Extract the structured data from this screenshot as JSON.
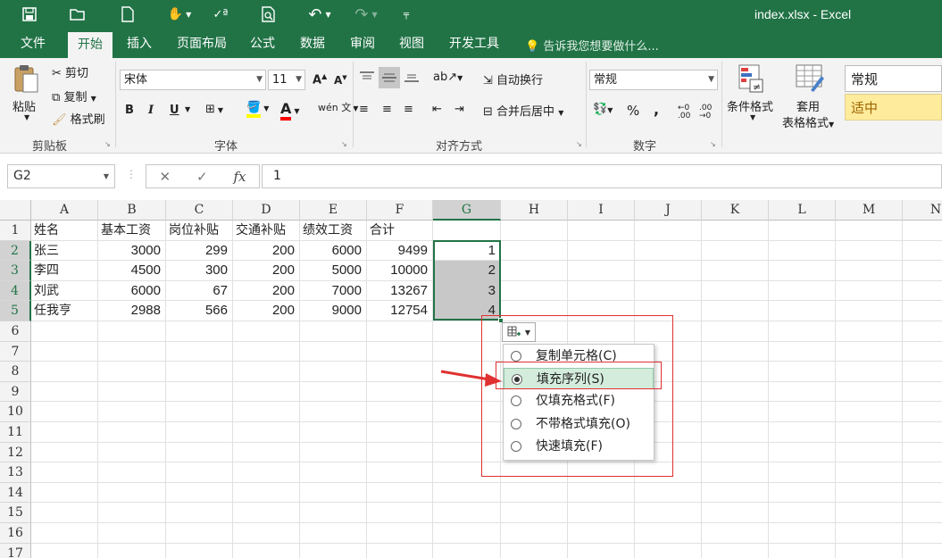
{
  "window": {
    "title": "index.xlsx - Excel"
  },
  "qat": {
    "undo_icon": "undo-icon",
    "redo_icon": "redo-icon"
  },
  "tabs": [
    "文件",
    "开始",
    "插入",
    "页面布局",
    "公式",
    "数据",
    "审阅",
    "视图",
    "开发工具"
  ],
  "tellme": "告诉我您想要做什么...",
  "clipboard": {
    "cut": "剪切",
    "copy": "复制",
    "paste": "粘贴",
    "format_painter": "格式刷",
    "label": "剪贴板"
  },
  "font": {
    "name": "宋体",
    "size": "11",
    "label": "字体",
    "grow": "A",
    "shrink": "A",
    "bold": "B",
    "italic": "I",
    "underline": "U",
    "wen": "wén 文"
  },
  "alignment": {
    "wrap": "自动换行",
    "merge": "合并后居中",
    "label": "对齐方式"
  },
  "number": {
    "format": "常规",
    "percent": "%",
    "comma": ",",
    "label": "数字",
    "inc_decimal": "←0 .00",
    "dec_decimal": ".00 →0"
  },
  "styles": {
    "conditional": "条件格式",
    "table_line1": "套用",
    "table_line2": "表格格式",
    "normal": "常规",
    "neutral": "适中"
  },
  "formula_bar": {
    "name_box": "G2",
    "formula": "1",
    "fx": "fx"
  },
  "columns": [
    "A",
    "B",
    "C",
    "D",
    "E",
    "F",
    "G",
    "H",
    "I",
    "J",
    "K",
    "L",
    "M",
    "N"
  ],
  "rows": [
    "1",
    "2",
    "3",
    "4",
    "5",
    "6",
    "7",
    "8",
    "9",
    "10",
    "11",
    "12",
    "13",
    "14",
    "15",
    "16",
    "17"
  ],
  "headers": [
    "姓名",
    "基本工资",
    "岗位补贴",
    "交通补贴",
    "绩效工资",
    "合计"
  ],
  "table": [
    {
      "name": "张三",
      "values": [
        "3000",
        "299",
        "200",
        "6000",
        "9499",
        "1"
      ]
    },
    {
      "name": "李四",
      "values": [
        "4500",
        "300",
        "200",
        "5000",
        "10000",
        "2"
      ]
    },
    {
      "name": "刘武",
      "values": [
        "6000",
        "67",
        "200",
        "7000",
        "13267",
        "3"
      ]
    },
    {
      "name": "任我亨",
      "values": [
        "2988",
        "566",
        "200",
        "9000",
        "12754",
        "4"
      ]
    }
  ],
  "autofill_menu": {
    "options": [
      "复制单元格(C)",
      "填充序列(S)",
      "仅填充格式(F)",
      "不带格式填充(O)",
      "快速填充(F)"
    ],
    "selected": "填充序列(S)"
  },
  "colors": {
    "excel_green": "#217346",
    "annotation_red": "#e03030"
  }
}
